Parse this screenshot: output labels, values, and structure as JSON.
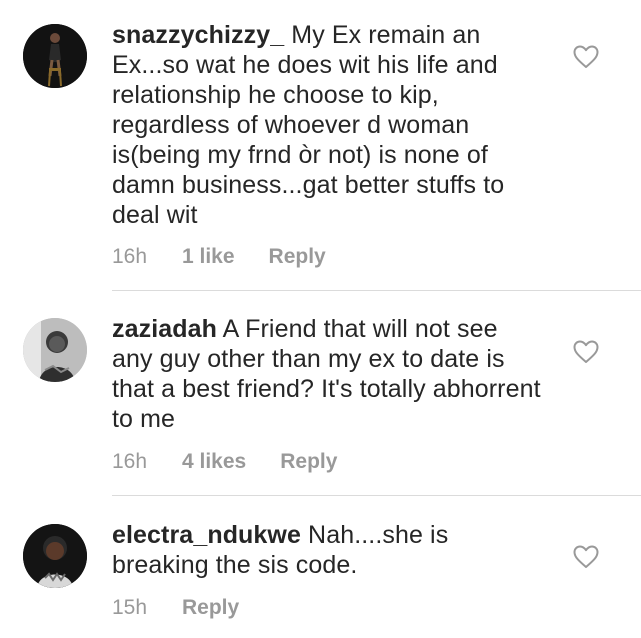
{
  "comments": [
    {
      "username": "snazzychizzy_",
      "text": "My Ex remain an Ex...so wat he does wit his life and relationship he choose to kip, regardless of whoever d woman is(being my frnd òr not) is none of damn business...gat better stuffs to deal wit",
      "time": "16h",
      "likes": "1 like",
      "reply_label": "Reply",
      "avatar_icon": "user-avatar-photo",
      "like_icon": "heart-outline-icon"
    },
    {
      "username": "zaziadah",
      "text": "A Friend that will not see any guy other than my ex to date is that a best friend? It's totally abhorrent to me",
      "time": "16h",
      "likes": "4 likes",
      "reply_label": "Reply",
      "avatar_icon": "user-avatar-photo",
      "like_icon": "heart-outline-icon"
    },
    {
      "username": "electra_ndukwe",
      "text": "Nah....she is breaking the sis code.",
      "time": "15h",
      "likes": "",
      "reply_label": "Reply",
      "avatar_icon": "user-avatar-photo",
      "like_icon": "heart-outline-icon"
    }
  ],
  "colors": {
    "text": "#262626",
    "meta": "#999999",
    "divider": "#dbdbdb",
    "heart": "#999999"
  }
}
